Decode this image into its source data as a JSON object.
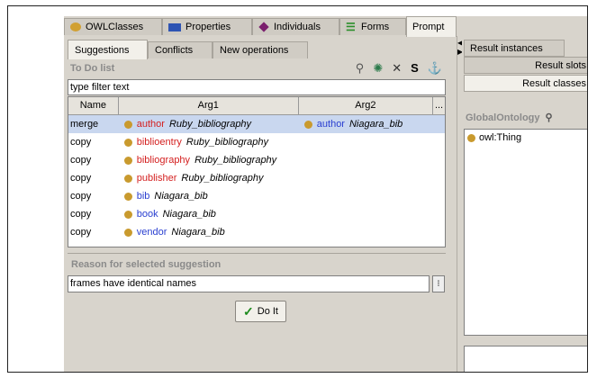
{
  "top_tabs": [
    {
      "label": "OWLClasses",
      "icon": "owl-classes-icon"
    },
    {
      "label": "Properties",
      "icon": "properties-icon"
    },
    {
      "label": "Individuals",
      "icon": "individuals-icon"
    },
    {
      "label": "Forms",
      "icon": "forms-icon"
    },
    {
      "label": "Prompt",
      "icon": ""
    }
  ],
  "sub_tabs": [
    "Suggestions",
    "Conflicts",
    "New operations"
  ],
  "todo": {
    "title": "To Do list",
    "toolbar_icons": [
      "user-icon",
      "bug-icon",
      "close-icon",
      "s-icon",
      "anchor-icon"
    ],
    "toolbar_glyphs": [
      "⚲",
      "✺",
      "✕",
      "S",
      "⚓"
    ],
    "filter_placeholder": "type filter text"
  },
  "table": {
    "headers": [
      "Name",
      "Arg1",
      "Arg2",
      "..."
    ],
    "rows": [
      {
        "name": "merge",
        "arg1_class": "author",
        "arg1_class_color": "red",
        "arg1_onto": "Ruby_bibliography",
        "arg2_class": "author",
        "arg2_class_color": "blue",
        "arg2_onto": "Niagara_bib",
        "selected": true
      },
      {
        "name": "copy",
        "arg1_class": "biblioentry",
        "arg1_class_color": "red",
        "arg1_onto": "Ruby_bibliography"
      },
      {
        "name": "copy",
        "arg1_class": "bibliography",
        "arg1_class_color": "red",
        "arg1_onto": "Ruby_bibliography"
      },
      {
        "name": "copy",
        "arg1_class": "publisher",
        "arg1_class_color": "red",
        "arg1_onto": "Ruby_bibliography"
      },
      {
        "name": "copy",
        "arg1_class": "bib",
        "arg1_class_color": "blue",
        "arg1_onto": "Niagara_bib"
      },
      {
        "name": "copy",
        "arg1_class": "book",
        "arg1_class_color": "blue",
        "arg1_onto": "Niagara_bib"
      },
      {
        "name": "copy",
        "arg1_class": "vendor",
        "arg1_class_color": "blue",
        "arg1_onto": "Niagara_bib"
      }
    ]
  },
  "reason": {
    "label": "Reason for selected suggestion",
    "value": "frames have identical names"
  },
  "do_it_label": "Do It",
  "right": {
    "tabs": [
      "Result instances",
      "Result slots",
      "Result classes"
    ],
    "ontology_label": "GlobalOntology",
    "items": [
      "owl:Thing"
    ]
  },
  "colors": {
    "red": "#d42020",
    "blue": "#2a3fd0",
    "class_dot": "#c99a2e",
    "selected_row": "#c9d7ef"
  }
}
